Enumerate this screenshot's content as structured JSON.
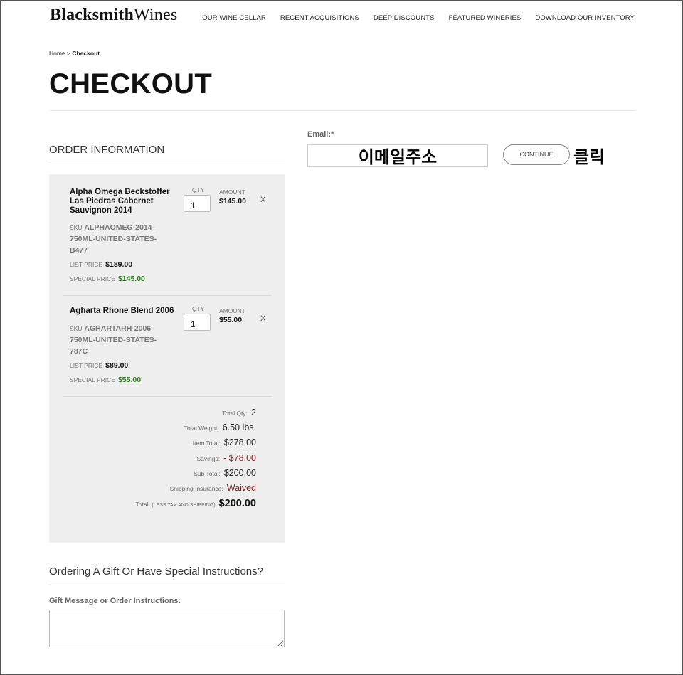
{
  "header": {
    "brand_bold": "Blacksmith",
    "brand_rest": "Wines",
    "nav": [
      "OUR WINE CELLAR",
      "RECENT ACQUISITIONS",
      "DEEP DISCOUNTS",
      "FEATURED WINERIES",
      "DOWNLOAD OUR INVENTORY"
    ]
  },
  "breadcrumb": {
    "home": "Home",
    "sep": " > ",
    "current": "Checkout"
  },
  "page_title": "CHECKOUT",
  "order": {
    "heading": "ORDER INFORMATION",
    "qty_label": "QTY",
    "amount_label": "AMOUNT",
    "remove_label": "X",
    "sku_label": "SKU",
    "list_label": "LIST PRICE",
    "special_label": "SPECIAL PRICE",
    "items": [
      {
        "name": "Alpha Omega Beckstoffer Las Piedras Cabernet Sauvignon 2014",
        "qty": "1",
        "amount": "$145.00",
        "sku": "ALPHAOMEG-2014-750ML-UNITED-STATES-B477",
        "list_price": "$189.00",
        "special_price": "$145.00"
      },
      {
        "name": "Agharta Rhone Blend 2006",
        "qty": "1",
        "amount": "$55.00",
        "sku": "AGHARTARH-2006-750ML-UNITED-STATES-787C",
        "list_price": "$89.00",
        "special_price": "$55.00"
      }
    ],
    "totals": {
      "qty_label": "Total Qty:",
      "qty": "2",
      "weight_label": "Total Weight:",
      "weight": "6.50 lbs.",
      "item_total_label": "Item Total:",
      "item_total": "$278.00",
      "savings_label": "Savings:",
      "savings": "- $78.00",
      "sub_total_label": "Sub Total:",
      "sub_total": "$200.00",
      "insurance_label": "Shipping Insurance:",
      "insurance": "Waived",
      "total_label": "Total:",
      "total_note": "(LESS TAX AND SHIPPING)",
      "total": "$200.00"
    }
  },
  "gift": {
    "heading": "Ordering A Gift Or Have Special Instructions?",
    "label": "Gift Message or Order Instructions:",
    "value": ""
  },
  "email": {
    "label": "Email:*",
    "annotation": "이메일주소",
    "continue_label": "CONTINUE",
    "click_annotation": "클릭"
  }
}
